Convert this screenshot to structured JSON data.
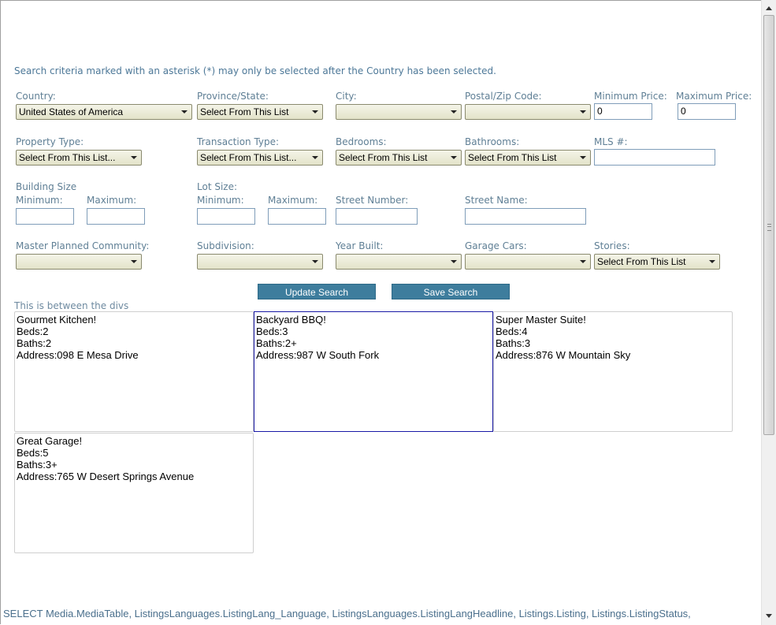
{
  "note": "Search criteria marked with an asterisk (*) may only be selected after the Country has been selected.",
  "fields": {
    "country": {
      "label": "Country:",
      "value": "United States of America"
    },
    "province": {
      "label": "Province/State:",
      "value": "Select From This List"
    },
    "city": {
      "label": "City:",
      "value": ""
    },
    "postal": {
      "label": "Postal/Zip Code:",
      "value": ""
    },
    "min_price": {
      "label": "Minimum Price:",
      "value": "0"
    },
    "max_price": {
      "label": "Maximum Price:",
      "value": "0"
    },
    "property_type": {
      "label": "Property Type:",
      "value": "Select From This List..."
    },
    "transaction_type": {
      "label": "Transaction Type:",
      "value": "Select From This List..."
    },
    "bedrooms": {
      "label": "Bedrooms:",
      "value": "Select From This List"
    },
    "bathrooms": {
      "label": "Bathrooms:",
      "value": "Select From This List"
    },
    "mls": {
      "label": "MLS #:",
      "value": ""
    },
    "building_size": {
      "label": "Building Size",
      "min_label": "Minimum:",
      "max_label": "Maximum:",
      "min_value": "",
      "max_value": ""
    },
    "lot_size": {
      "label": "Lot Size:",
      "min_label": "Minimum:",
      "max_label": "Maximum:",
      "min_value": "",
      "max_value": ""
    },
    "street_number": {
      "label": "Street Number:",
      "value": ""
    },
    "street_name": {
      "label": "Street Name:",
      "value": ""
    },
    "master_planned": {
      "label": "Master Planned Community:",
      "value": ""
    },
    "subdivision": {
      "label": "Subdivision:",
      "value": ""
    },
    "year_built": {
      "label": "Year Built:",
      "value": ""
    },
    "garage_cars": {
      "label": "Garage Cars:",
      "value": ""
    },
    "stories": {
      "label": "Stories:",
      "value": "Select From This List"
    }
  },
  "buttons": {
    "update": "Update Search",
    "save": "Save Search"
  },
  "between_text": "This is between the divs",
  "listings": [
    {
      "headline": "Gourmet Kitchen!",
      "beds": "Beds:2",
      "baths": "Baths:2",
      "address": "Address:098 E Mesa Drive"
    },
    {
      "headline": "Backyard BBQ!",
      "beds": "Beds:3",
      "baths": "Baths:2+",
      "address": "Address:987 W South Fork"
    },
    {
      "headline": "Super Master Suite!",
      "beds": "Beds:4",
      "baths": "Baths:3",
      "address": "Address:876 W Mountain Sky"
    },
    {
      "headline": "Great Garage!",
      "beds": "Beds:5",
      "baths": "Baths:3+",
      "address": "Address:765 W Desert Springs Avenue"
    }
  ],
  "sql_text": "SELECT Media.MediaTable, ListingsLanguages.ListingLang_Language, ListingsLanguages.ListingLangHeadline, Listings.Listing, Listings.ListingStatus,"
}
